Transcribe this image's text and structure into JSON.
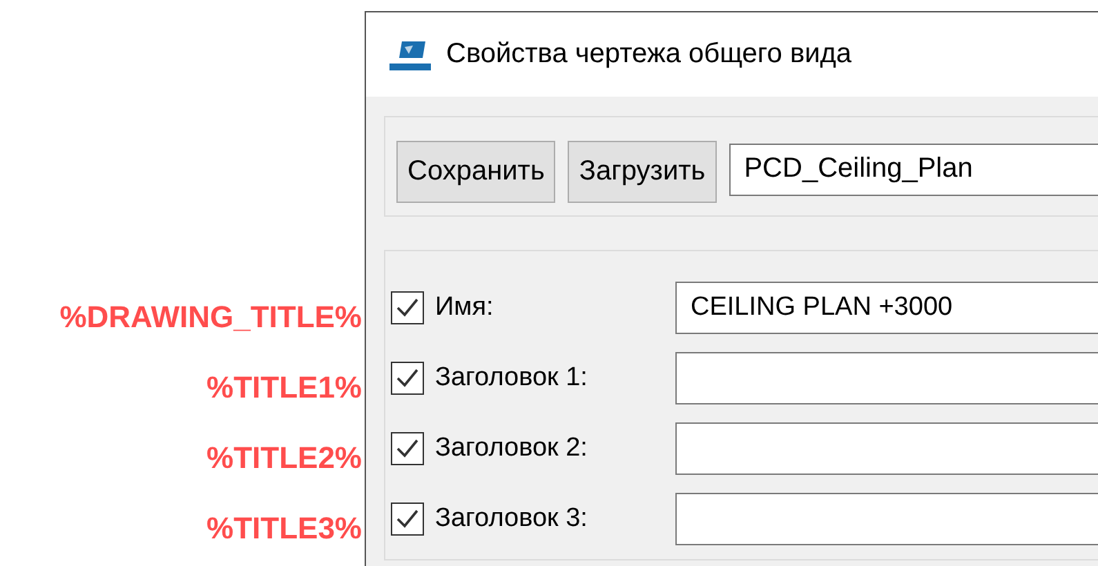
{
  "annotations": [
    "%DRAWING_TITLE%",
    "%TITLE1%",
    "%TITLE2%",
    "%TITLE3%"
  ],
  "window": {
    "title": "Свойства чертежа общего вида"
  },
  "toolbar": {
    "buttons": [
      "Сохранить",
      "Загрузить"
    ],
    "template_field": {
      "value": "PCD_Ceiling_Plan"
    }
  },
  "fields": [
    {
      "label": "Имя:",
      "checked": true,
      "value": "CEILING PLAN +3000"
    },
    {
      "label": "Заголовок 1:",
      "checked": true
    },
    {
      "label": "Заголовок 2:",
      "checked": true
    },
    {
      "label": "Заголовок 3:",
      "checked": true
    }
  ]
}
